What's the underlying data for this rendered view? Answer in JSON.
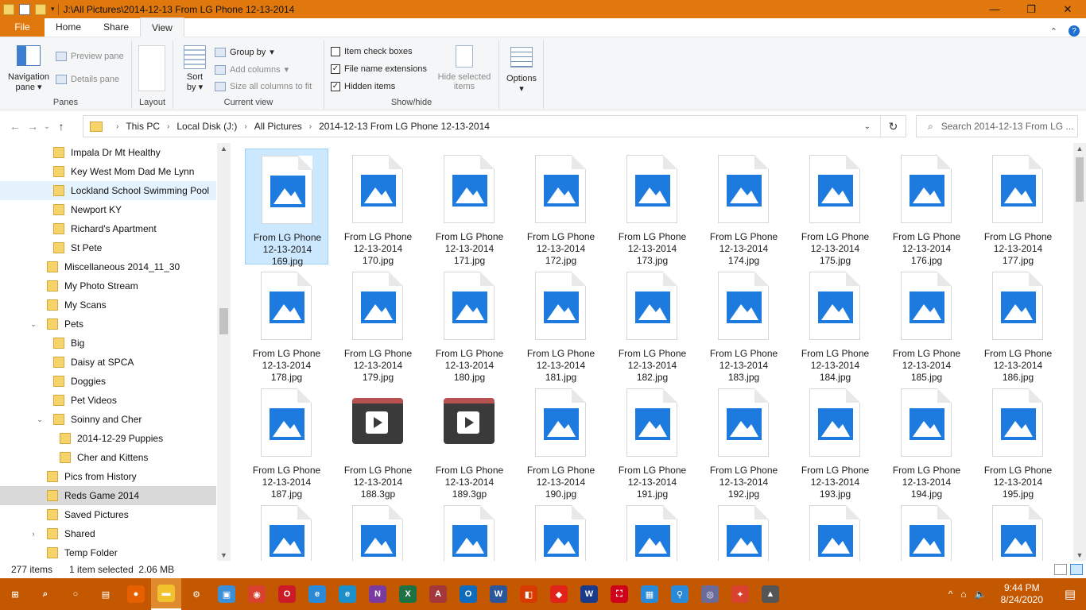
{
  "window": {
    "title": "J:\\All Pictures\\2014-12-13 From LG Phone 12-13-2014",
    "controls": [
      "—",
      "❐",
      "✕"
    ]
  },
  "ribbon_tabs": [
    "File",
    "Home",
    "Share",
    "View"
  ],
  "ribbon": {
    "panes": {
      "nav_pane_line1": "Navigation",
      "nav_pane_line2": "pane",
      "preview_pane": "Preview pane",
      "details_pane": "Details pane",
      "label": "Panes"
    },
    "layout": {
      "label": "Layout"
    },
    "current_view": {
      "sort_line1": "Sort",
      "sort_line2": "by",
      "group_by": "Group by",
      "add_columns": "Add columns",
      "size_columns": "Size all columns to fit",
      "label": "Current view"
    },
    "show_hide": {
      "item_check_boxes": "Item check boxes",
      "file_name_extensions": "File name extensions",
      "hidden_items": "Hidden items",
      "hide_selected_line1": "Hide selected",
      "hide_selected_line2": "items",
      "label": "Show/hide",
      "checked": {
        "item_check_boxes": false,
        "file_name_extensions": true,
        "hidden_items": true
      }
    },
    "options": {
      "label": "Options"
    }
  },
  "address": {
    "crumbs": [
      "This PC",
      "Local Disk (J:)",
      "All Pictures",
      "2014-12-13 From LG Phone 12-13-2014"
    ],
    "search_placeholder": "Search 2014-12-13 From LG ..."
  },
  "nav_items": [
    {
      "label": "Impala Dr Mt Healthy",
      "indent": 2
    },
    {
      "label": "Key West Mom Dad Me Lynn",
      "indent": 2
    },
    {
      "label": "Lockland School Swimming Pool",
      "indent": 2,
      "state": "hover"
    },
    {
      "label": "Newport KY",
      "indent": 2
    },
    {
      "label": "Richard's Apartment",
      "indent": 2
    },
    {
      "label": "St Pete",
      "indent": 2
    },
    {
      "label": "Miscellaneous 2014_11_30",
      "indent": 1
    },
    {
      "label": "My Photo Stream",
      "indent": 1
    },
    {
      "label": "My Scans",
      "indent": 1
    },
    {
      "label": "Pets",
      "indent": 1,
      "expander": "⌄"
    },
    {
      "label": "Big",
      "indent": 2
    },
    {
      "label": "Daisy at SPCA",
      "indent": 2
    },
    {
      "label": "Doggies",
      "indent": 2
    },
    {
      "label": "Pet Videos",
      "indent": 2
    },
    {
      "label": "Soinny and Cher",
      "indent": 2,
      "expander": "⌄"
    },
    {
      "label": "2014-12-29 Puppies",
      "indent": 3
    },
    {
      "label": "Cher and Kittens",
      "indent": 3
    },
    {
      "label": "Pics from History",
      "indent": 1
    },
    {
      "label": "Reds Game 2014",
      "indent": 1,
      "state": "focus"
    },
    {
      "label": "Saved Pictures",
      "indent": 1
    },
    {
      "label": "Shared",
      "indent": 1,
      "expander": "›"
    },
    {
      "label": "Temp Folder",
      "indent": 1
    }
  ],
  "files": [
    {
      "l1": "From LG Phone",
      "l2": "12-13-2014",
      "l3": "169.jpg",
      "type": "image",
      "selected": true
    },
    {
      "l1": "From LG Phone",
      "l2": "12-13-2014",
      "l3": "170.jpg",
      "type": "image"
    },
    {
      "l1": "From LG Phone",
      "l2": "12-13-2014",
      "l3": "171.jpg",
      "type": "image"
    },
    {
      "l1": "From LG Phone",
      "l2": "12-13-2014",
      "l3": "172.jpg",
      "type": "image"
    },
    {
      "l1": "From LG Phone",
      "l2": "12-13-2014",
      "l3": "173.jpg",
      "type": "image"
    },
    {
      "l1": "From LG Phone",
      "l2": "12-13-2014",
      "l3": "174.jpg",
      "type": "image"
    },
    {
      "l1": "From LG Phone",
      "l2": "12-13-2014",
      "l3": "175.jpg",
      "type": "image"
    },
    {
      "l1": "From LG Phone",
      "l2": "12-13-2014",
      "l3": "176.jpg",
      "type": "image"
    },
    {
      "l1": "From LG Phone",
      "l2": "12-13-2014",
      "l3": "177.jpg",
      "type": "image"
    },
    {
      "l1": "From LG Phone",
      "l2": "12-13-2014",
      "l3": "178.jpg",
      "type": "image"
    },
    {
      "l1": "From LG Phone",
      "l2": "12-13-2014",
      "l3": "179.jpg",
      "type": "image"
    },
    {
      "l1": "From LG Phone",
      "l2": "12-13-2014",
      "l3": "180.jpg",
      "type": "image"
    },
    {
      "l1": "From LG Phone",
      "l2": "12-13-2014",
      "l3": "181.jpg",
      "type": "image"
    },
    {
      "l1": "From LG Phone",
      "l2": "12-13-2014",
      "l3": "182.jpg",
      "type": "image"
    },
    {
      "l1": "From LG Phone",
      "l2": "12-13-2014",
      "l3": "183.jpg",
      "type": "image"
    },
    {
      "l1": "From LG Phone",
      "l2": "12-13-2014",
      "l3": "184.jpg",
      "type": "image"
    },
    {
      "l1": "From LG Phone",
      "l2": "12-13-2014",
      "l3": "185.jpg",
      "type": "image"
    },
    {
      "l1": "From LG Phone",
      "l2": "12-13-2014",
      "l3": "186.jpg",
      "type": "image"
    },
    {
      "l1": "From LG Phone",
      "l2": "12-13-2014",
      "l3": "187.jpg",
      "type": "image"
    },
    {
      "l1": "From LG Phone",
      "l2": "12-13-2014",
      "l3": "188.3gp",
      "type": "video"
    },
    {
      "l1": "From LG Phone",
      "l2": "12-13-2014",
      "l3": "189.3gp",
      "type": "video"
    },
    {
      "l1": "From LG Phone",
      "l2": "12-13-2014",
      "l3": "190.jpg",
      "type": "image"
    },
    {
      "l1": "From LG Phone",
      "l2": "12-13-2014",
      "l3": "191.jpg",
      "type": "image"
    },
    {
      "l1": "From LG Phone",
      "l2": "12-13-2014",
      "l3": "192.jpg",
      "type": "image"
    },
    {
      "l1": "From LG Phone",
      "l2": "12-13-2014",
      "l3": "193.jpg",
      "type": "image"
    },
    {
      "l1": "From LG Phone",
      "l2": "12-13-2014",
      "l3": "194.jpg",
      "type": "image"
    },
    {
      "l1": "From LG Phone",
      "l2": "12-13-2014",
      "l3": "195.jpg",
      "type": "image"
    },
    {
      "type": "image"
    },
    {
      "type": "image"
    },
    {
      "type": "image"
    },
    {
      "type": "image"
    },
    {
      "type": "image"
    },
    {
      "type": "image"
    },
    {
      "type": "image"
    },
    {
      "type": "image"
    },
    {
      "type": "image"
    }
  ],
  "status": {
    "item_count": "277 items",
    "selection": "1 item selected  2.06 MB"
  },
  "taskbar": {
    "time": "9:44 PM",
    "date": "8/24/2020",
    "apps": [
      {
        "name": "start-icon",
        "glyph": "⊞",
        "color": "transparent"
      },
      {
        "name": "search-icon",
        "glyph": "⌕",
        "color": "transparent"
      },
      {
        "name": "cortana-icon",
        "glyph": "○",
        "color": "transparent"
      },
      {
        "name": "task-view-icon",
        "glyph": "▤",
        "color": "transparent"
      },
      {
        "name": "firefox-icon",
        "glyph": "●",
        "color": "#e66000"
      },
      {
        "name": "file-explorer-icon",
        "glyph": "▬",
        "color": "#f2c12e",
        "active": true
      },
      {
        "name": "settings-icon",
        "glyph": "⚙",
        "color": "transparent"
      },
      {
        "name": "control-panel-icon",
        "glyph": "▣",
        "color": "#3b8fd8"
      },
      {
        "name": "chrome-icon",
        "glyph": "◉",
        "color": "#d9412f"
      },
      {
        "name": "opera-icon",
        "glyph": "O",
        "color": "#cc1b27"
      },
      {
        "name": "internet-explorer-icon",
        "glyph": "e",
        "color": "#2a8ad8"
      },
      {
        "name": "edge-icon",
        "glyph": "e",
        "color": "#1a8fc9"
      },
      {
        "name": "onenote-icon",
        "glyph": "N",
        "color": "#7b3aa0"
      },
      {
        "name": "excel-icon",
        "glyph": "X",
        "color": "#1e7145"
      },
      {
        "name": "access-icon",
        "glyph": "A",
        "color": "#a4373a"
      },
      {
        "name": "outlook-icon",
        "glyph": "O",
        "color": "#0f6cbd"
      },
      {
        "name": "word-icon",
        "glyph": "W",
        "color": "#2b579a"
      },
      {
        "name": "office-icon",
        "glyph": "◧",
        "color": "#d83b01"
      },
      {
        "name": "acrobat-icon",
        "glyph": "◆",
        "color": "#e2231a"
      },
      {
        "name": "wordperfect-icon",
        "glyph": "W",
        "color": "#1a3a8a"
      },
      {
        "name": "pdf-icon",
        "glyph": "⛶",
        "color": "#d0021b"
      },
      {
        "name": "network-icon",
        "glyph": "▦",
        "color": "#2a8ad8"
      },
      {
        "name": "maps-icon",
        "glyph": "⚲",
        "color": "#2a8ad8"
      },
      {
        "name": "disc-icon",
        "glyph": "◎",
        "color": "#6b6b9a"
      },
      {
        "name": "malwarebytes-icon",
        "glyph": "✦",
        "color": "#d9412f"
      },
      {
        "name": "photos-icon",
        "glyph": "▲",
        "color": "#555"
      }
    ],
    "tray": [
      "^",
      "⌂",
      "🔈"
    ]
  }
}
